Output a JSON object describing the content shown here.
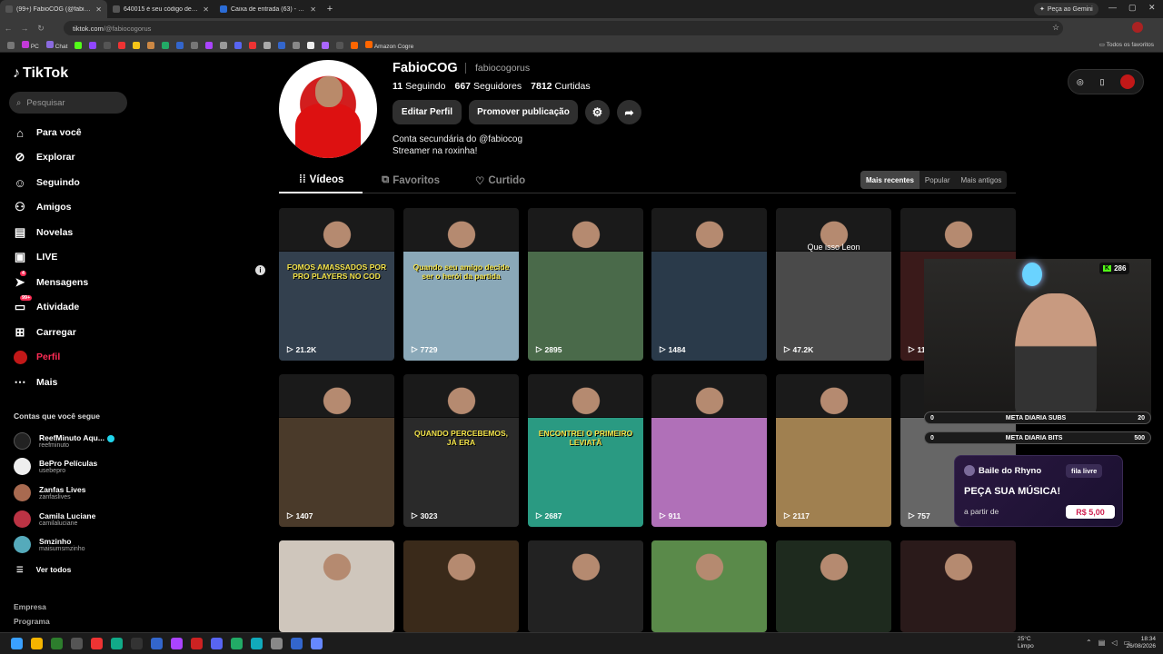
{
  "browser": {
    "tabs": [
      {
        "title": "(99+) FabioCOG (@fabiocogorus)",
        "active": true
      },
      {
        "title": "640015 é seu código de 6 dígitos",
        "active": false
      },
      {
        "title": "Caixa de entrada (63) - E-mail",
        "active": false
      }
    ],
    "new_tab": "+",
    "gemini_label": "Peça ao Gemini",
    "url_host": "tiktok.com",
    "url_path": "/@fabiocogorus",
    "bookmarks": [
      "PC",
      "Chat",
      "Amazon Cogre"
    ],
    "bookmarks_right": "Todos os favoritos"
  },
  "sidebar": {
    "logo": "TikTok",
    "search_placeholder": "Pesquisar",
    "nav": [
      {
        "label": "Para você",
        "icon": "home-icon"
      },
      {
        "label": "Explorar",
        "icon": "compass-icon"
      },
      {
        "label": "Seguindo",
        "icon": "following-icon"
      },
      {
        "label": "Amigos",
        "icon": "friends-icon"
      },
      {
        "label": "Novelas",
        "icon": "novelas-icon"
      },
      {
        "label": "LIVE",
        "icon": "live-icon"
      },
      {
        "label": "Mensagens",
        "icon": "messages-icon",
        "badge": "4"
      },
      {
        "label": "Atividade",
        "icon": "activity-icon",
        "badge": "99+"
      },
      {
        "label": "Carregar",
        "icon": "upload-icon"
      },
      {
        "label": "Perfil",
        "icon": "profile-icon",
        "active": true
      },
      {
        "label": "Mais",
        "icon": "more-icon"
      }
    ],
    "following_title": "Contas que você segue",
    "accounts": [
      {
        "name": "ReefMinuto Aqu...",
        "handle": "reefminuto",
        "verified": true
      },
      {
        "name": "BePro Películas",
        "handle": "usebepro"
      },
      {
        "name": "Zanfas Lives",
        "handle": "zanfaslives"
      },
      {
        "name": "Camila Luciane",
        "handle": "camilaluciane"
      },
      {
        "name": "Smzinho",
        "handle": "maisumsmzinho"
      }
    ],
    "see_all": "Ver todos",
    "footer": [
      "Empresa",
      "Programa"
    ]
  },
  "profile": {
    "display_name": "FabioCOG",
    "handle": "fabiocogorus",
    "following": "11",
    "following_label": "Seguindo",
    "followers": "667",
    "followers_label": "Seguidores",
    "likes": "7812",
    "likes_label": "Curtidas",
    "edit_label": "Editar Perfil",
    "promote_label": "Promover publicação",
    "bio_line1": "Conta secundária do @fabiocog",
    "bio_line2": "Streamer na roxinha!"
  },
  "content_tabs": [
    {
      "label": "Vídeos",
      "active": true
    },
    {
      "label": "Favoritos",
      "active": false
    },
    {
      "label": "Curtido",
      "active": false
    }
  ],
  "sort": [
    {
      "label": "Mais recentes",
      "active": true
    },
    {
      "label": "Popular",
      "active": false
    },
    {
      "label": "Mais antigos",
      "active": false
    }
  ],
  "videos": [
    {
      "views": "21.2K",
      "caption": "FOMOS AMASSADOS POR PRO PLAYERS NO COD",
      "bg": "#33404e"
    },
    {
      "views": "7729",
      "caption": "Quando seu amigo decide ser o herói da partida",
      "bg": "#8aa8b8"
    },
    {
      "views": "2895",
      "caption": "",
      "bg": "#4a6a4a"
    },
    {
      "views": "1484",
      "caption": "",
      "bg": "#2a3a4a"
    },
    {
      "views": "47.2K",
      "caption": "Que isso Leon",
      "bg": "#4a4a4a"
    },
    {
      "views": "11",
      "caption": "",
      "bg": "#3a1a1a"
    },
    {
      "views": "1407",
      "caption": "",
      "bg": "#4a3a2a"
    },
    {
      "views": "3023",
      "caption": "QUANDO PERCEBEMOS, JÁ ERA",
      "bg": "#2a2a2a"
    },
    {
      "views": "2687",
      "caption": "ENCONTREI O PRIMEIRO LEVIATÃ",
      "bg": "#2a9a82"
    },
    {
      "views": "911",
      "caption": "",
      "bg": "#b070b8"
    },
    {
      "views": "2117",
      "caption": "",
      "bg": "#a08050"
    },
    {
      "views": "757",
      "caption": "",
      "bg": "#666"
    },
    {
      "views": "",
      "caption": "",
      "bg": "#cfc6bc"
    },
    {
      "views": "",
      "caption": "",
      "bg": "#3a2a1a"
    },
    {
      "views": "",
      "caption": "",
      "bg": "#222"
    },
    {
      "views": "",
      "caption": "",
      "bg": "#5a8a4a"
    },
    {
      "views": "",
      "caption": "",
      "bg": "#1e2a1e"
    },
    {
      "views": "",
      "caption": "",
      "bg": "#2a1a1a"
    }
  ],
  "overlay": {
    "kick_count": "286",
    "goal1_label": "META DIARIA SUBS",
    "goal1_left": "0",
    "goal1_right": "20",
    "goal2_label": "META DIARIA BITS",
    "goal2_left": "0",
    "goal2_right": "500",
    "music_title": "Baile do Rhyno",
    "music_queue": "fila livre",
    "music_cta": "PEÇA SUA MÚSICA!",
    "music_from": "a partir de",
    "music_price": "R$ 5,00"
  },
  "taskbar": {
    "temp": "25°C",
    "weather": "Limpo",
    "time": "18:34",
    "date": "26/08/2026"
  }
}
